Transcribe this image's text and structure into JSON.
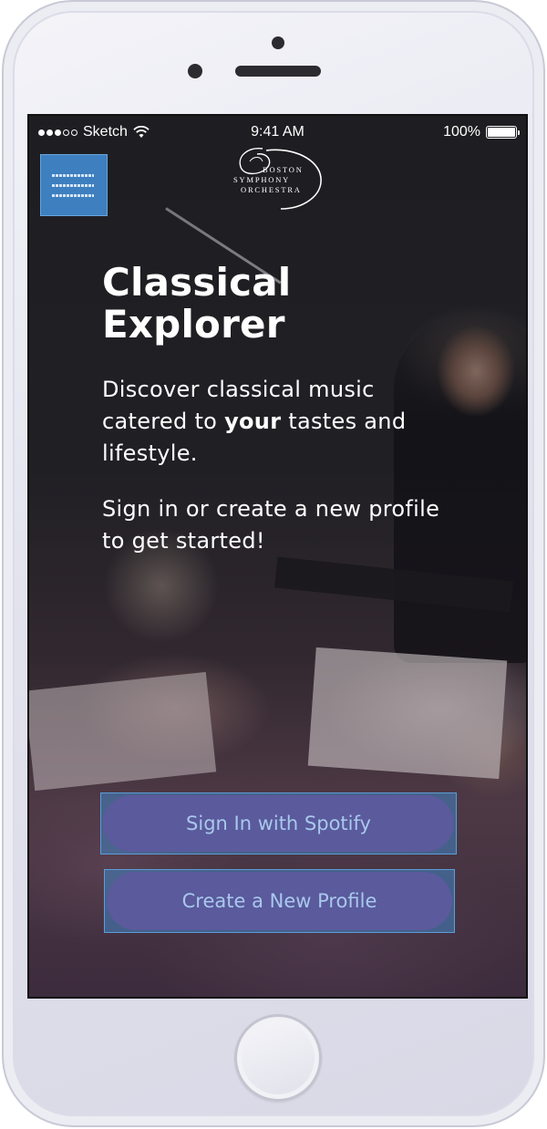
{
  "status_bar": {
    "carrier": "Sketch",
    "time": "9:41 AM",
    "battery": "100%"
  },
  "header": {
    "menu_icon": "hamburger-menu-icon",
    "logo": {
      "line1": "BOSTON",
      "line2": "SYMPHONY",
      "line3": "ORCHESTRA"
    }
  },
  "hero": {
    "title_line1": "Classical",
    "title_line2": "Explorer",
    "intro_before": "Discover classical music catered to ",
    "intro_bold": "your",
    "intro_after": " tastes and lifestyle.",
    "cta": "Sign in or create a new profile to get started!"
  },
  "actions": {
    "signin_label": "Sign In with Spotify",
    "create_label": "Create a New Profile"
  },
  "colors": {
    "menu_button": "#3d7fbf",
    "primary_button": "#5a5a9c",
    "button_text": "#a9c8ec"
  }
}
